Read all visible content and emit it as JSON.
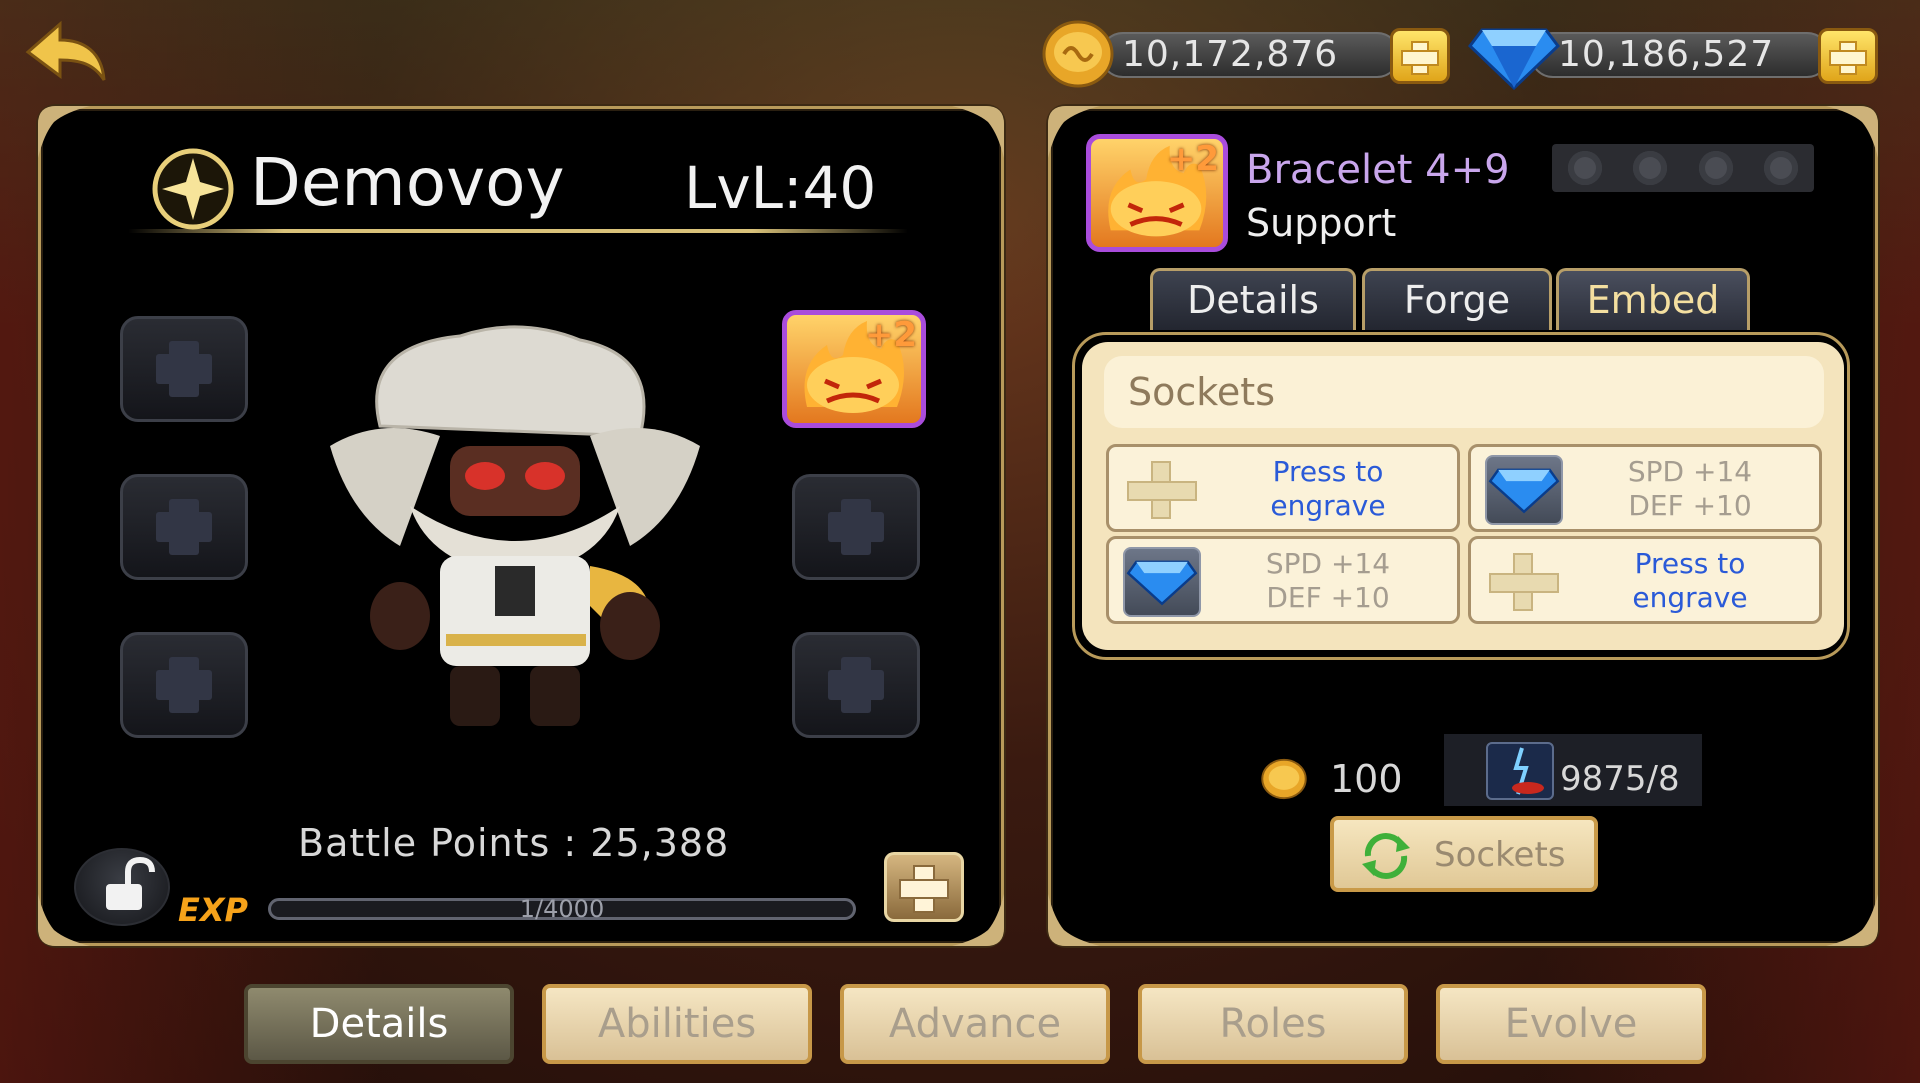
{
  "resources": {
    "gold": {
      "value": "10,172,876",
      "icon": "gold-coin-icon"
    },
    "diamond": {
      "value": "10,186,527",
      "icon": "diamond-icon"
    }
  },
  "hero": {
    "name": "Demovoy",
    "level": "LvL:40",
    "battle_points": "Battle Points : 25,388",
    "exp_label": "EXP",
    "exp_text": "1/4000",
    "exp_progress": 0.00025,
    "equipped_plus": "+2"
  },
  "item": {
    "name": "Bracelet 4+9",
    "type": "Support",
    "plus": "+2",
    "stars": 4
  },
  "item_tabs": [
    {
      "label": "Details"
    },
    {
      "label": "Forge"
    },
    {
      "label": "Embed"
    }
  ],
  "sockets": {
    "title": "Sockets",
    "cells": [
      {
        "kind": "empty",
        "line1": "Press to",
        "line2": "engrave"
      },
      {
        "kind": "gem",
        "line1": "SPD +14",
        "line2": "DEF +10"
      },
      {
        "kind": "gem",
        "line1": "SPD +14",
        "line2": "DEF +10"
      },
      {
        "kind": "empty",
        "line1": "Press to",
        "line2": "engrave"
      }
    ],
    "cost_gold": "100",
    "material_count": "9875/8",
    "button_label": "Sockets"
  },
  "bottom_tabs": [
    {
      "label": "Details"
    },
    {
      "label": "Abilities"
    },
    {
      "label": "Advance"
    },
    {
      "label": "Roles"
    },
    {
      "label": "Evolve"
    }
  ],
  "colors": {
    "accent_gold": "#b89a5a",
    "item_name": "#c9a6ec",
    "engrave_link": "#2a5ad8",
    "exp_orange": "#f6a21a"
  }
}
